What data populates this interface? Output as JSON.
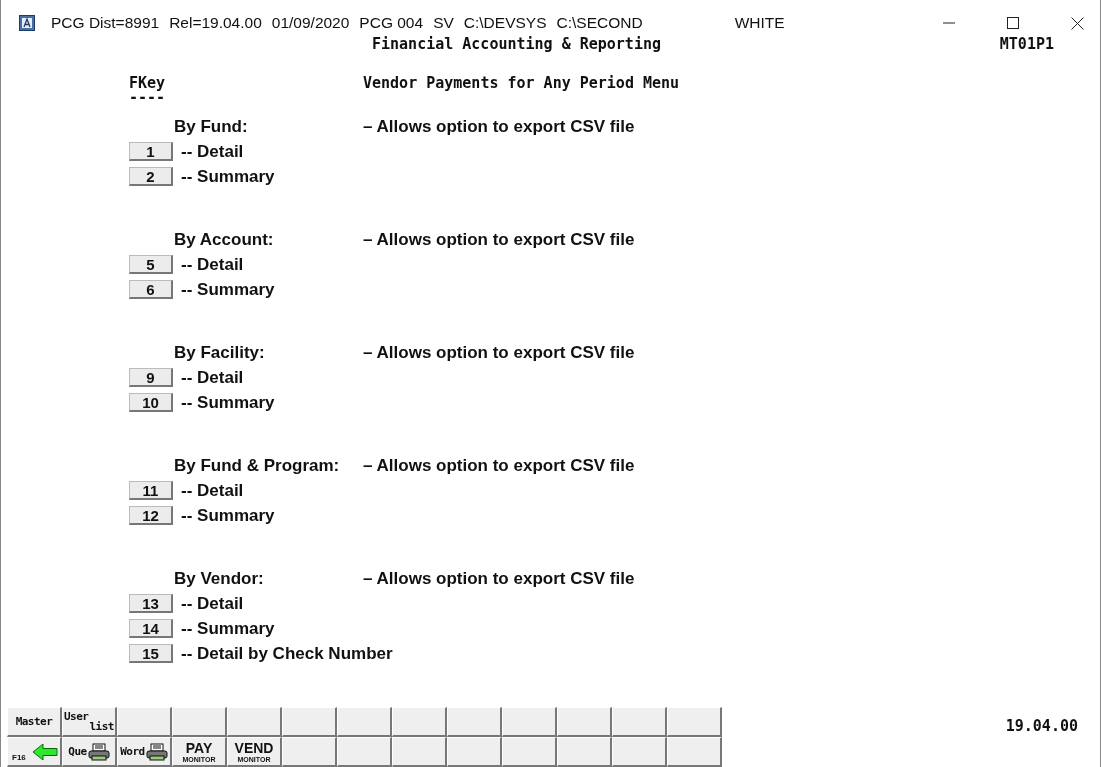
{
  "window": {
    "title_parts": [
      "PCG Dist=8991",
      "Rel=19.04.00",
      "01/09/2020",
      "PCG 004",
      "SV",
      "C:\\DEVSYS",
      "C:\\SECOND"
    ],
    "theme": "WHITE"
  },
  "header": {
    "title": "Financial Accounting & Reporting",
    "screen_id": "MT01P1"
  },
  "menu": {
    "fkey_heading": "FKey",
    "underline": "----",
    "title": "Vendor Payments for Any Period Menu",
    "sections": [
      {
        "label": "By Fund:",
        "description": "– Allows option to export CSV file",
        "options": [
          {
            "key": "1",
            "text": "-- Detail"
          },
          {
            "key": "2",
            "text": "-- Summary"
          }
        ]
      },
      {
        "label": "By Account:",
        "description": "– Allows option to export CSV file",
        "options": [
          {
            "key": "5",
            "text": "-- Detail"
          },
          {
            "key": "6",
            "text": "-- Summary"
          }
        ]
      },
      {
        "label": "By Facility:",
        "description": "– Allows option to export CSV file",
        "options": [
          {
            "key": "9",
            "text": "-- Detail"
          },
          {
            "key": "10",
            "text": "-- Summary"
          }
        ]
      },
      {
        "label": "By Fund & Program:",
        "description": "– Allows option to export CSV file",
        "options": [
          {
            "key": "11",
            "text": "-- Detail"
          },
          {
            "key": "12",
            "text": "-- Summary"
          }
        ]
      },
      {
        "label": "By Vendor:",
        "description": "– Allows option to export CSV file",
        "options": [
          {
            "key": "13",
            "text": "-- Detail"
          },
          {
            "key": "14",
            "text": "-- Summary"
          },
          {
            "key": "15",
            "text": "-- Detail by Check Number"
          }
        ]
      }
    ]
  },
  "toolbar": {
    "rows": [
      [
        {
          "kind": "text",
          "label": "Master"
        },
        {
          "kind": "stack",
          "top": "User",
          "bottom": "list"
        },
        {
          "kind": "empty"
        },
        {
          "kind": "empty"
        },
        {
          "kind": "empty"
        },
        {
          "kind": "empty"
        },
        {
          "kind": "empty"
        },
        {
          "kind": "empty"
        },
        {
          "kind": "empty"
        },
        {
          "kind": "empty"
        },
        {
          "kind": "empty"
        },
        {
          "kind": "empty"
        },
        {
          "kind": "empty"
        }
      ],
      [
        {
          "kind": "back",
          "label": "F16"
        },
        {
          "kind": "printer",
          "label": "Que"
        },
        {
          "kind": "printer",
          "label": "Word"
        },
        {
          "kind": "monitor",
          "label": "PAY",
          "sub": "MONITOR"
        },
        {
          "kind": "monitor",
          "label": "VEND",
          "sub": "MONITOR"
        },
        {
          "kind": "empty"
        },
        {
          "kind": "empty"
        },
        {
          "kind": "empty"
        },
        {
          "kind": "empty"
        },
        {
          "kind": "empty"
        },
        {
          "kind": "empty"
        },
        {
          "kind": "empty"
        },
        {
          "kind": "empty"
        }
      ]
    ]
  },
  "version": "19.04.00"
}
